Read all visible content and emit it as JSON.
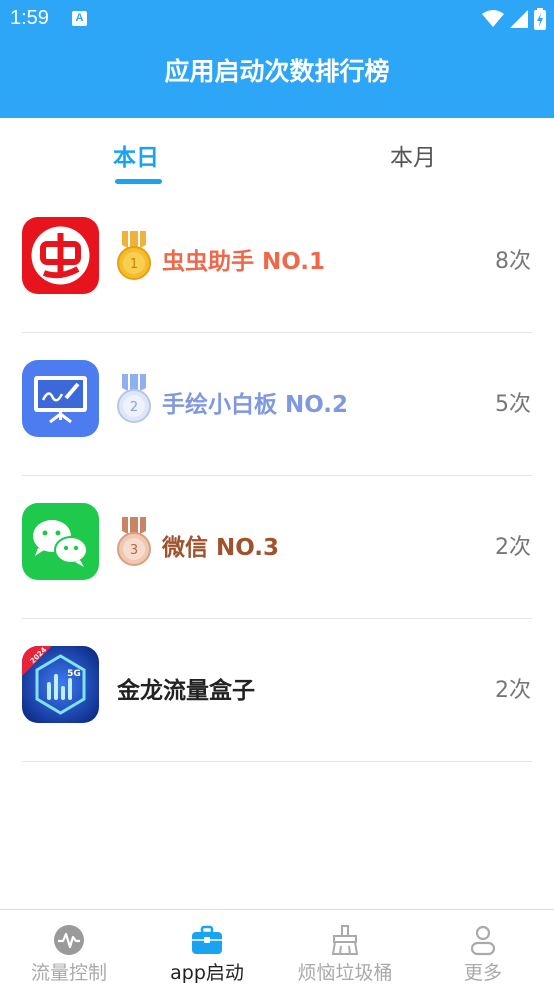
{
  "status_bar": {
    "time": "1:59",
    "notification_letter": "A"
  },
  "header": {
    "title": "应用启动次数排行榜"
  },
  "tabs": [
    {
      "label": "本日",
      "active": true
    },
    {
      "label": "本月",
      "active": false
    }
  ],
  "apps": [
    {
      "name": "虫虫助手 NO.1",
      "count": "8次",
      "medal": "gold",
      "medal_number": "1",
      "name_color": "#f0684a",
      "icon": "chongchong-app-icon"
    },
    {
      "name": "手绘小白板 NO.2",
      "count": "5次",
      "medal": "silver",
      "medal_number": "2",
      "name_color": "#7f98e0",
      "icon": "whiteboard-app-icon"
    },
    {
      "name": "微信 NO.3",
      "count": "2次",
      "medal": "bronze",
      "medal_number": "3",
      "name_color": "#a0522d",
      "icon": "wechat-app-icon"
    },
    {
      "name": "金龙流量盒子",
      "count": "2次",
      "medal": "none",
      "name_color": "#222222",
      "icon": "traffic-box-app-icon",
      "icon_badge": "2024",
      "icon_text": "5G"
    }
  ],
  "bottom_nav": [
    {
      "label": "流量控制",
      "icon": "traffic-control-icon",
      "active": false
    },
    {
      "label": "app启动",
      "icon": "app-launch-icon",
      "active": true
    },
    {
      "label": "烦恼垃圾桶",
      "icon": "trash-bin-icon",
      "active": false
    },
    {
      "label": "更多",
      "icon": "more-user-icon",
      "active": false
    }
  ],
  "colors": {
    "primary": "#2ea6f8",
    "tab_active": "#1aa3f0",
    "nav_active": "#1aa3f0",
    "nav_inactive": "#aaaaaa"
  }
}
